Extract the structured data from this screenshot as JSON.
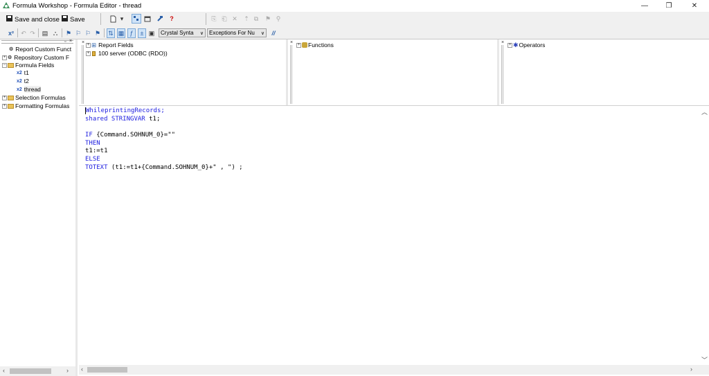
{
  "window": {
    "title": "Formula Workshop - Formula Editor - thread",
    "minimize": "—",
    "restore": "❐",
    "close": "✕"
  },
  "toolbar": {
    "save_close_label": "Save and close",
    "save_label": "Save",
    "syntax_dropdown": "Crystal Synta",
    "exceptions_dropdown": "Exceptions For Nu",
    "comment_label": "//"
  },
  "left_tree": {
    "items": [
      {
        "label": "Report Custom Funct"
      },
      {
        "label": "Repository Custom F"
      },
      {
        "label": "Formula Fields"
      },
      {
        "label": "t1"
      },
      {
        "label": "t2"
      },
      {
        "label": "thread"
      },
      {
        "label": "Selection Formulas"
      },
      {
        "label": "Formatting Formulas"
      }
    ]
  },
  "fields_pane": {
    "items": [
      {
        "label": "Report Fields"
      },
      {
        "label": "100 server (ODBC (RDO))"
      }
    ]
  },
  "functions_pane": {
    "label": "Functions"
  },
  "operators_pane": {
    "label": "Operators"
  },
  "editor": {
    "lines": [
      {
        "text": "WhileprintingRecords;"
      },
      {
        "a": "shared STRINGVAR",
        "b": " t1;"
      },
      {
        "text": ""
      },
      {
        "a": "IF",
        "b": " {Command.SOHNUM_0}=\"\""
      },
      {
        "text": "THEN"
      },
      {
        "text": "t1:=t1"
      },
      {
        "text": "ELSE"
      },
      {
        "a": "TOTEXT",
        "b": " (t1:=t1+{Command.SOHNUM_0}+\" , \") ;"
      }
    ]
  },
  "colors": {
    "keyword": "#2020e0",
    "folder": "#e9c35a"
  }
}
